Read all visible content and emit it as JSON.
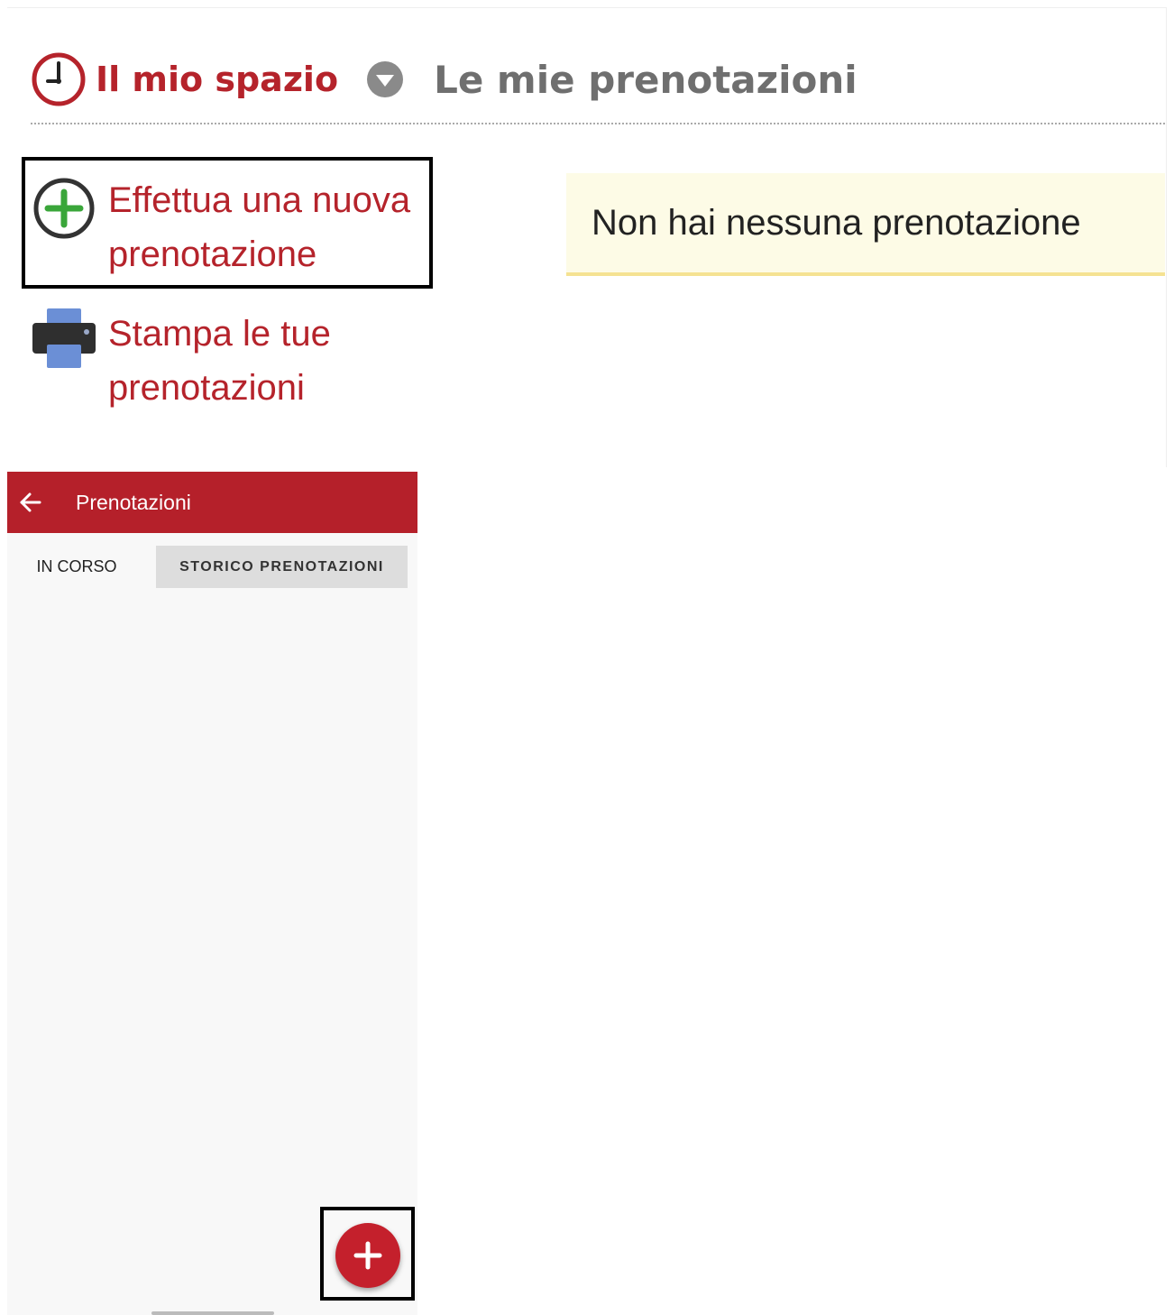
{
  "breadcrumb": {
    "home_label": "Il mio spazio",
    "current_label": "Le mie prenotazioni",
    "home_icon": "clock-icon",
    "separator_icon": "chevron-down-circle-icon"
  },
  "actions": {
    "new_booking": {
      "label": "Effettua una nuova prenotazione",
      "icon": "plus-circle-icon"
    },
    "print": {
      "label": "Stampa le tue prenotazioni",
      "icon": "printer-icon"
    }
  },
  "notice": {
    "text": "Non hai nessuna prenotazione"
  },
  "app": {
    "title": "Prenotazioni",
    "back_icon": "arrow-back-icon",
    "tabs": [
      {
        "label": "IN CORSO"
      },
      {
        "label": "STORICO PRENOTAZIONI"
      }
    ],
    "fab_icon": "plus-icon"
  },
  "colors": {
    "brand_red": "#b5232b",
    "notice_bg": "#fdfbe6",
    "notice_border": "#f5e292",
    "plus_green": "#3aa63a",
    "printer_blue": "#6b8fd6"
  }
}
